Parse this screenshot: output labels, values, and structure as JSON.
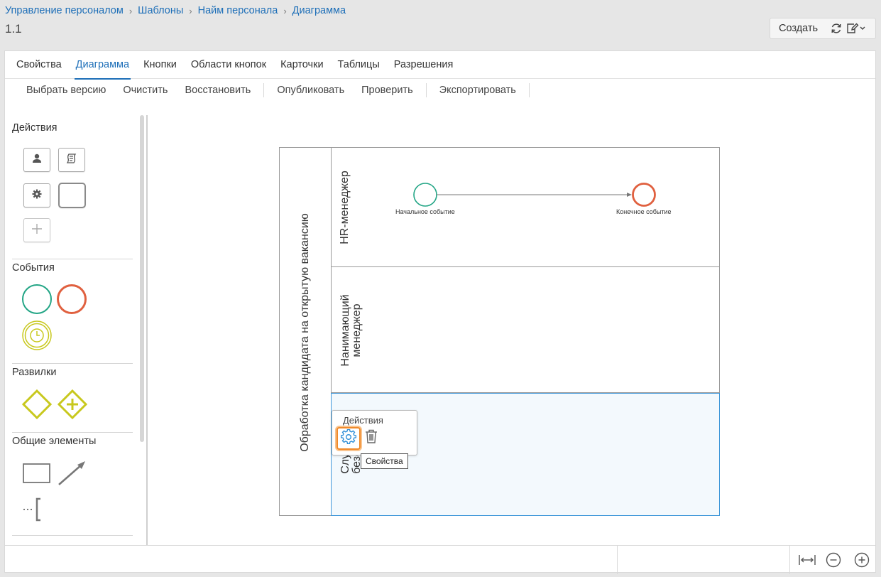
{
  "breadcrumb": [
    "Управление персоналом",
    "Шаблоны",
    "Найм персонала",
    "Диаграмма"
  ],
  "version": "1.1",
  "header": {
    "create_label": "Создать",
    "refresh_icon": "refresh-icon",
    "edit_icon": "edit-icon"
  },
  "tabs": [
    {
      "label": "Свойства",
      "active": false
    },
    {
      "label": "Диаграмма",
      "active": true
    },
    {
      "label": "Кнопки",
      "active": false
    },
    {
      "label": "Области кнопок",
      "active": false
    },
    {
      "label": "Карточки",
      "active": false
    },
    {
      "label": "Таблицы",
      "active": false
    },
    {
      "label": "Разрешения",
      "active": false
    }
  ],
  "toolbar": {
    "select_version": "Выбрать версию",
    "clear": "Очистить",
    "restore": "Восстановить",
    "publish": "Опубликовать",
    "check": "Проверить",
    "export": "Экспортировать"
  },
  "palette": {
    "actions_header": "Действия",
    "events_header": "События",
    "gateways_header": "Развилки",
    "common_header": "Общие элементы"
  },
  "diagram": {
    "pool_label": "Обработка кандидата на открытую вакансию",
    "lanes": [
      {
        "label": "HR-менеджер"
      },
      {
        "label_line1": "Нанимающий",
        "label_line2": "менеджер"
      },
      {
        "label_line1": "Слу",
        "label_line2": "безо"
      }
    ],
    "start_event_label": "Начальное событие",
    "end_event_label": "Конечное событие"
  },
  "popup": {
    "title": "Действия",
    "tooltip": "Свойства"
  },
  "colors": {
    "accent": "#1e6fb8",
    "start": "#22a585",
    "end": "#e0603f",
    "timer": "#c8c81e",
    "selection": "#3f97d9",
    "highlight": "#f08a2a"
  }
}
